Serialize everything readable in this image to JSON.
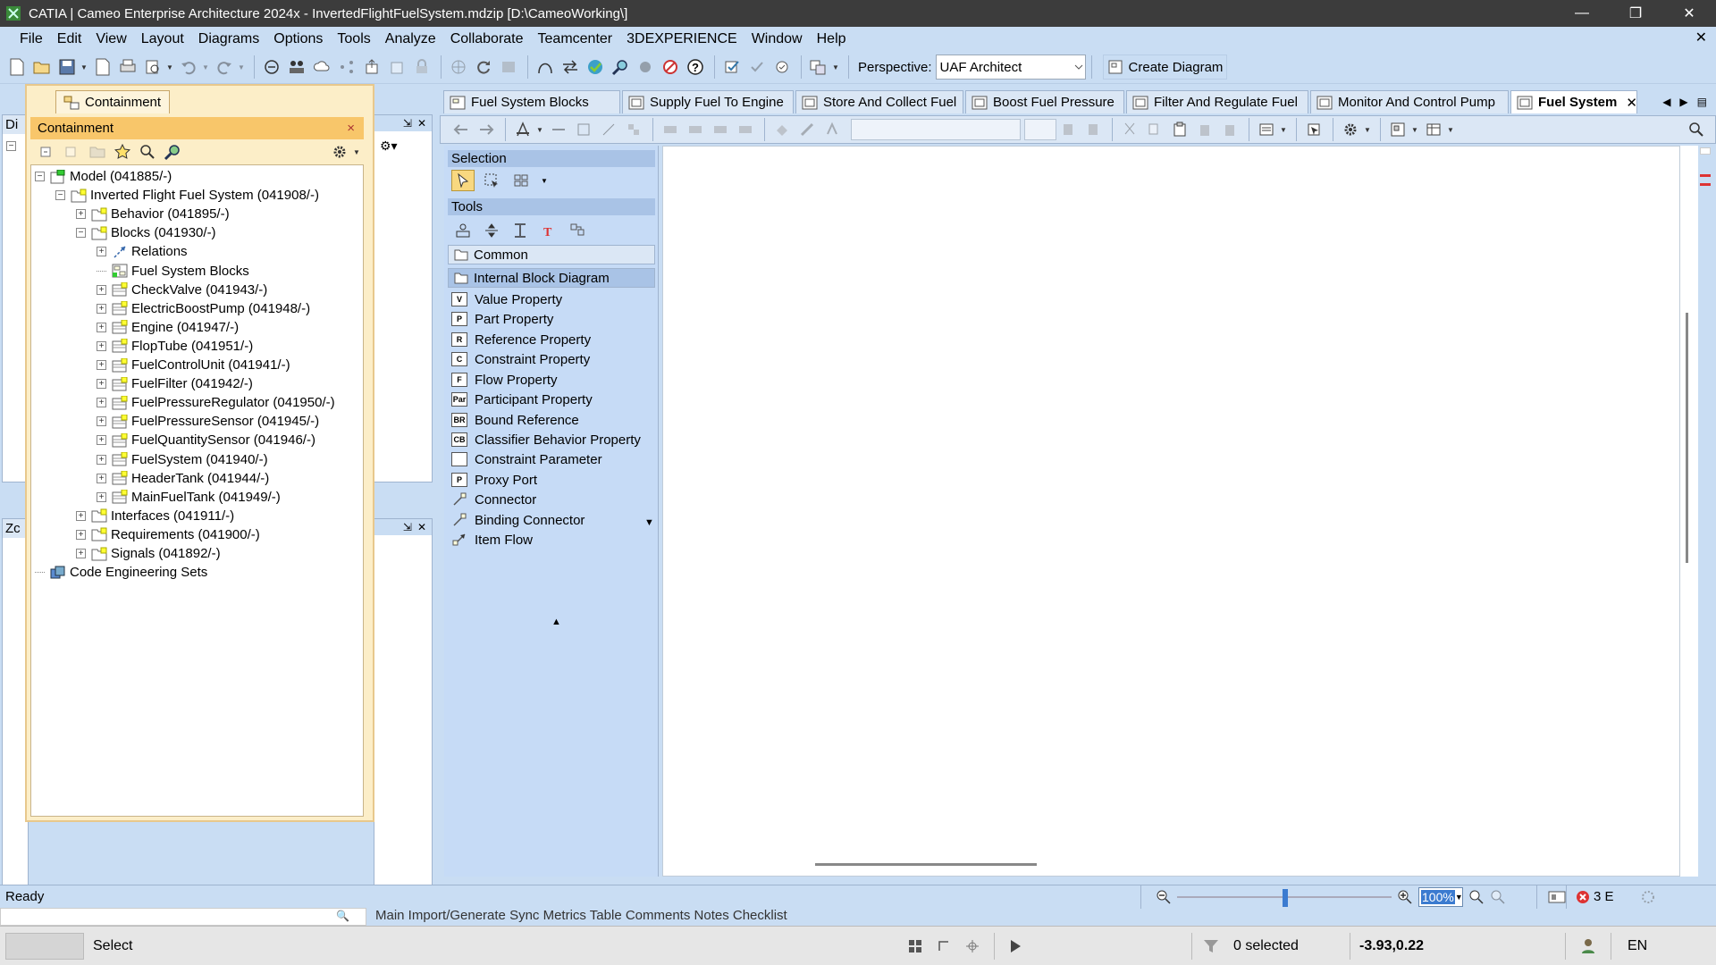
{
  "window": {
    "title": "CATIA | Cameo Enterprise Architecture 2024x - InvertedFlightFuelSystem.mdzip [D:\\CameoWorking\\]",
    "minimize": "—",
    "restore": "❐",
    "close": "✕"
  },
  "menu": {
    "items": [
      "File",
      "Edit",
      "View",
      "Layout",
      "Diagrams",
      "Options",
      "Tools",
      "Analyze",
      "Collaborate",
      "Teamcenter",
      "3DEXPERIENCE",
      "Window",
      "Help"
    ],
    "close_glyph": "✕"
  },
  "toolbar": {
    "perspective_label": "Perspective:",
    "perspective_value": "UAF Architect",
    "create_diagram_label": "Create Diagram"
  },
  "containment": {
    "tab_label": "Containment",
    "header_label": "Containment",
    "close_glyph": "×",
    "tree": [
      {
        "label": "Model (041885/-)",
        "level": 0,
        "expander": "minus",
        "icon": "model"
      },
      {
        "label": "Inverted Flight Fuel System (041908/-)",
        "level": 1,
        "expander": "minus",
        "icon": "package"
      },
      {
        "label": "Behavior (041895/-)",
        "level": 2,
        "expander": "plus",
        "icon": "package"
      },
      {
        "label": "Blocks (041930/-)",
        "level": 2,
        "expander": "minus",
        "icon": "package"
      },
      {
        "label": "Relations",
        "level": 3,
        "expander": "plus",
        "icon": "relation"
      },
      {
        "label": "Fuel System Blocks",
        "level": 3,
        "expander": "none",
        "icon": "diagram"
      },
      {
        "label": "CheckValve (041943/-)",
        "level": 3,
        "expander": "plus",
        "icon": "block"
      },
      {
        "label": "ElectricBoostPump (041948/-)",
        "level": 3,
        "expander": "plus",
        "icon": "block"
      },
      {
        "label": "Engine (041947/-)",
        "level": 3,
        "expander": "plus",
        "icon": "block"
      },
      {
        "label": "FlopTube (041951/-)",
        "level": 3,
        "expander": "plus",
        "icon": "block"
      },
      {
        "label": "FuelControlUnit (041941/-)",
        "level": 3,
        "expander": "plus",
        "icon": "block"
      },
      {
        "label": "FuelFilter (041942/-)",
        "level": 3,
        "expander": "plus",
        "icon": "block"
      },
      {
        "label": "FuelPressureRegulator (041950/-)",
        "level": 3,
        "expander": "plus",
        "icon": "block"
      },
      {
        "label": "FuelPressureSensor (041945/-)",
        "level": 3,
        "expander": "plus",
        "icon": "block"
      },
      {
        "label": "FuelQuantitySensor (041946/-)",
        "level": 3,
        "expander": "plus",
        "icon": "block"
      },
      {
        "label": "FuelSystem (041940/-)",
        "level": 3,
        "expander": "plus",
        "icon": "block"
      },
      {
        "label": "HeaderTank (041944/-)",
        "level": 3,
        "expander": "plus",
        "icon": "block"
      },
      {
        "label": "MainFuelTank (041949/-)",
        "level": 3,
        "expander": "plus",
        "icon": "block"
      },
      {
        "label": "Interfaces (041911/-)",
        "level": 2,
        "expander": "plus",
        "icon": "package"
      },
      {
        "label": "Requirements (041900/-)",
        "level": 2,
        "expander": "plus",
        "icon": "package"
      },
      {
        "label": "Signals (041892/-)",
        "level": 2,
        "expander": "plus",
        "icon": "package"
      },
      {
        "label": "Code Engineering Sets",
        "level": 0,
        "expander": "none",
        "icon": "codeset"
      }
    ]
  },
  "side_panes": {
    "top_label": "Di",
    "bottom_label": "Zc"
  },
  "tabs": [
    {
      "label": "Fuel System Blocks",
      "active": false
    },
    {
      "label": "Supply Fuel To Engine",
      "active": false
    },
    {
      "label": "Store And Collect Fuel",
      "active": false
    },
    {
      "label": "Boost Fuel Pressure",
      "active": false
    },
    {
      "label": "Filter And Regulate Fuel",
      "active": false
    },
    {
      "label": "Monitor And Control Pump",
      "active": false
    },
    {
      "label": "Fuel System",
      "active": true
    }
  ],
  "tab_close_glyph": "✕",
  "palette": {
    "selection_label": "Selection",
    "tools_label": "Tools",
    "common_label": "Common",
    "ibd_label": "Internal Block Diagram",
    "items": [
      {
        "label": "Value Property",
        "glyph": "V"
      },
      {
        "label": "Part Property",
        "glyph": "P"
      },
      {
        "label": "Reference Property",
        "glyph": "R"
      },
      {
        "label": "Constraint Property",
        "glyph": "C"
      },
      {
        "label": "Flow Property",
        "glyph": "F"
      },
      {
        "label": "Participant Property",
        "glyph": "Par"
      },
      {
        "label": "Bound Reference",
        "glyph": "BR"
      },
      {
        "label": "Classifier Behavior Property",
        "glyph": "CB"
      },
      {
        "label": "Constraint Parameter",
        "glyph": ""
      },
      {
        "label": "Proxy Port",
        "glyph": "P"
      },
      {
        "label": "Connector",
        "glyph": "conn"
      },
      {
        "label": "Binding Connector",
        "glyph": "conn"
      },
      {
        "label": "Item Flow",
        "glyph": "flow"
      }
    ]
  },
  "status": {
    "ready": "Ready",
    "zoom": "100%",
    "errors": "3 E",
    "bottom_tabs": "Main    Import/Generate    Sync    Metrics Table    Comments    Notes    Checklist",
    "select_label": "Select",
    "selected_count": "0 selected",
    "coordinates": "-3.93,0.22",
    "language": "EN"
  },
  "colors": {
    "chrome": "#c9ddf3",
    "containment_header": "#f8c66a",
    "palette_bg": "#c6dbf6",
    "title_bar": "#3c3c3c"
  }
}
